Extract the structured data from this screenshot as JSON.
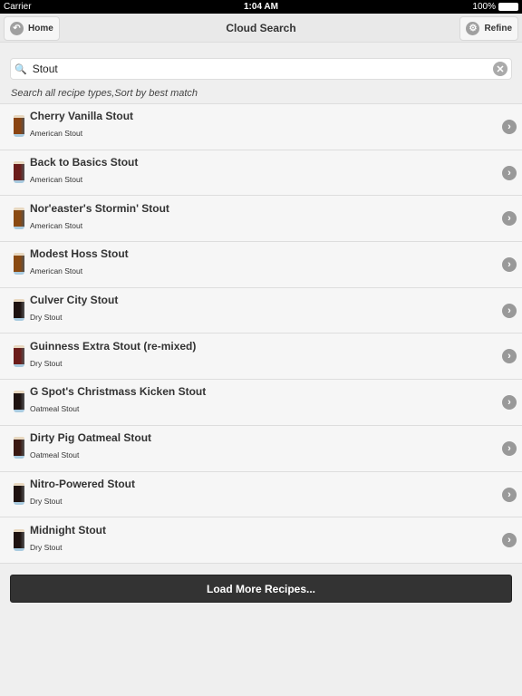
{
  "status": {
    "carrier": "Carrier",
    "time": "1:04 AM",
    "battery": "100%"
  },
  "nav": {
    "title": "Cloud Search",
    "home": "Home",
    "refine": "Refine"
  },
  "search": {
    "value": "Stout",
    "hint": "Search all recipe types,Sort by best match"
  },
  "recipes": [
    {
      "name": "Cherry Vanilla Stout",
      "style": "American Stout",
      "color": "#8a4412"
    },
    {
      "name": "Back to Basics Stout",
      "style": "American Stout",
      "color": "#6b1c1a"
    },
    {
      "name": "Nor'easter's Stormin' Stout",
      "style": "American Stout",
      "color": "#8a4a12"
    },
    {
      "name": "Modest Hoss Stout",
      "style": "American Stout",
      "color": "#8a4a12"
    },
    {
      "name": "Culver City Stout",
      "style": "Dry Stout",
      "color": "#1e1210"
    },
    {
      "name": "Guinness Extra Stout (re-mixed)",
      "style": "Dry Stout",
      "color": "#6b1c1a"
    },
    {
      "name": "G Spot's Christmass Kicken Stout",
      "style": "Oatmeal Stout",
      "color": "#1e1210"
    },
    {
      "name": "Dirty Pig Oatmeal Stout",
      "style": "Oatmeal Stout",
      "color": "#3a1812"
    },
    {
      "name": "Nitro-Powered Stout",
      "style": "Dry Stout",
      "color": "#1e1210"
    },
    {
      "name": "Midnight Stout",
      "style": "Dry Stout",
      "color": "#1e1210"
    }
  ],
  "load_more": "Load More Recipes..."
}
